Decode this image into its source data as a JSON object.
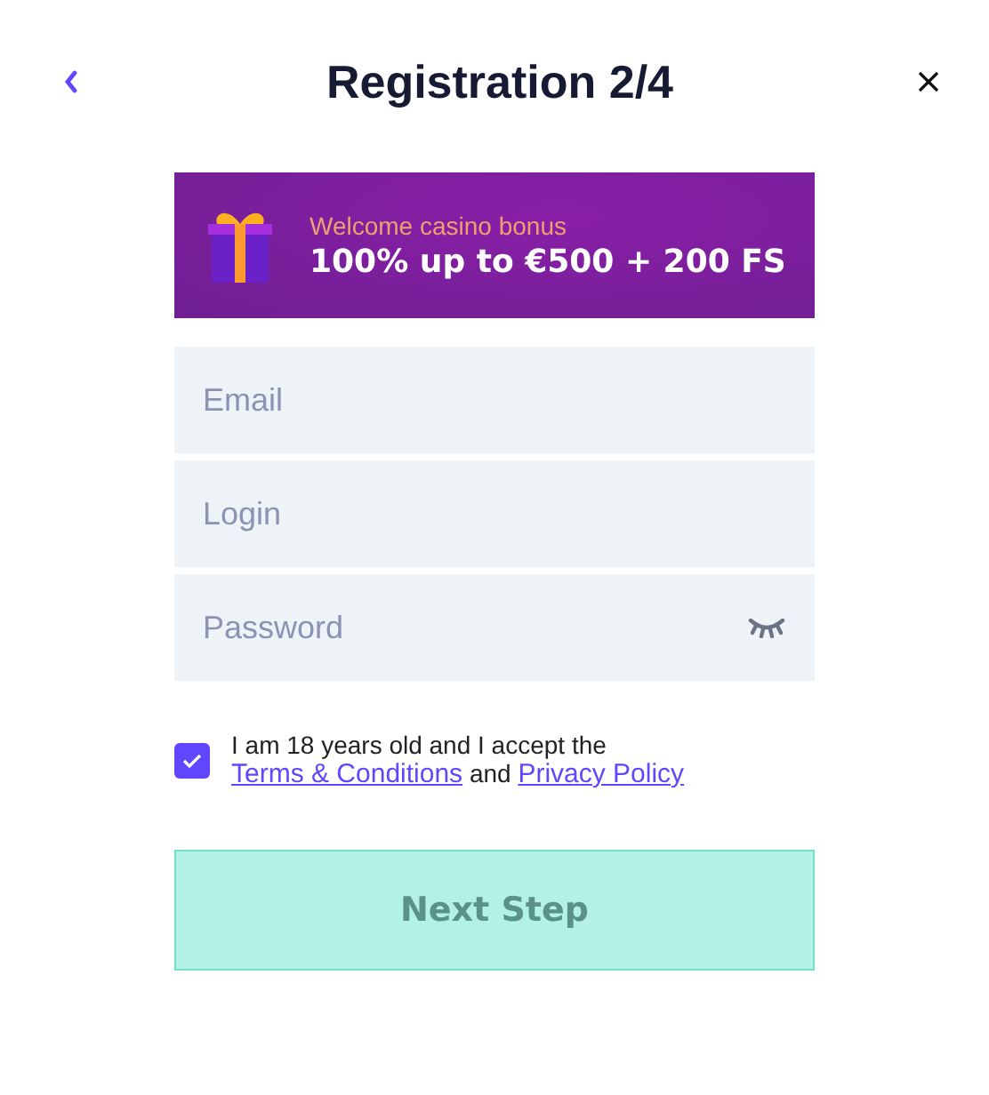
{
  "header": {
    "title": "Registration 2/4"
  },
  "bonus": {
    "subtitle": "Welcome casino bonus",
    "headline": "100% up to €500 + 200 FS"
  },
  "fields": [
    {
      "placeholder": "Email",
      "kind": "text"
    },
    {
      "placeholder": "Login",
      "kind": "text"
    },
    {
      "placeholder": "Password",
      "kind": "password"
    }
  ],
  "consent": {
    "checked": true,
    "text": "I am 18 years old and I accept the",
    "link_1": "Terms & Conditions",
    "joiner": "and",
    "link_2": "Privacy Policy"
  },
  "submit": {
    "label": "Next Step",
    "disabled": true
  }
}
